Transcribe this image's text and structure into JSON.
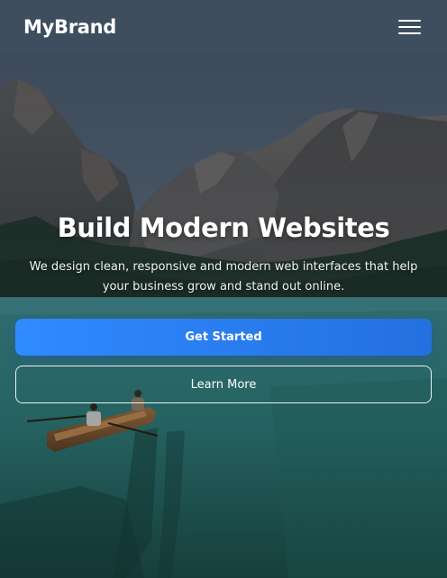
{
  "navbar": {
    "brand": "MyBrand",
    "menu_icon": "hamburger-menu-icon"
  },
  "hero": {
    "title": "Build Modern Websites",
    "subtitle": "We design clean, responsive and modern web interfaces that help your business grow and stand out online.",
    "primary_button": "Get Started",
    "secondary_button": "Learn More"
  },
  "colors": {
    "primary": "#2f8bff",
    "navbar_bg": "#405060",
    "text": "#ffffff"
  }
}
